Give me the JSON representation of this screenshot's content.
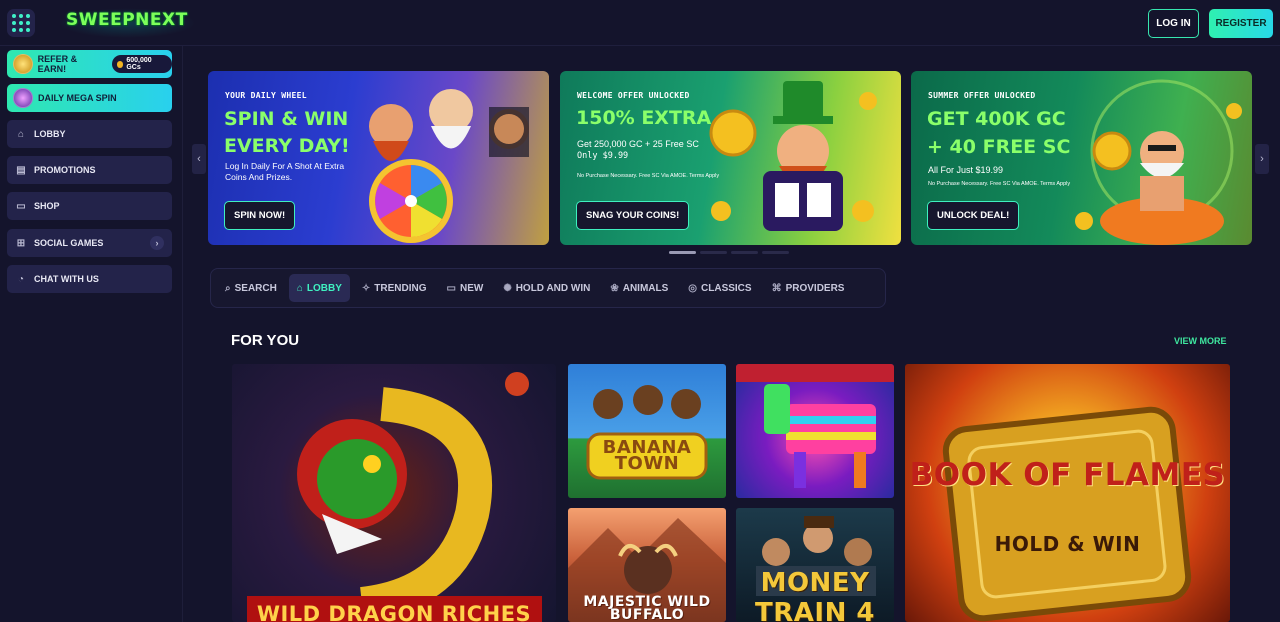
{
  "header": {
    "logo_text": "SWEEPNEXT",
    "login_label": "LOG IN",
    "register_label": "REGISTER"
  },
  "sidebar": {
    "refer": {
      "label": "REFER & EARN!",
      "badge": "600,000 GCs"
    },
    "mega_spin": {
      "label": "DAILY MEGA SPIN"
    },
    "items": [
      {
        "label": "LOBBY",
        "icon": "home-icon"
      },
      {
        "label": "PROMOTIONS",
        "icon": "gift-icon"
      },
      {
        "label": "SHOP",
        "icon": "shop-icon"
      },
      {
        "label": "SOCIAL GAMES",
        "icon": "games-icon"
      },
      {
        "label": "CHAT WITH US",
        "icon": "chat-icon"
      }
    ]
  },
  "banners": [
    {
      "kicker": "YOUR DAILY WHEEL",
      "title": "SPIN & WIN EVERY DAY!",
      "desc": "Log In Daily For A Shot At Extra Coins And Prizes.",
      "button": "SPIN NOW!"
    },
    {
      "kicker": "WELCOME OFFER UNLOCKED",
      "title": "150% EXTRA",
      "desc_line1": "Get 250,000 GC + 25 Free SC",
      "desc_line2": "Only $9.99",
      "fine": "No Purchase Necessary. Free SC Via AMOE. Terms Apply",
      "button": "SNAG YOUR COINS!"
    },
    {
      "kicker": "SUMMER OFFER UNLOCKED",
      "title": "GET 400K GC + 40 FREE SC",
      "desc_line1": "All For Just $19.99",
      "fine": "No Purchase Necessary. Free SC Via AMOE. Terms Apply",
      "button": "UNLOCK DEAL!"
    }
  ],
  "filters": [
    {
      "label": "SEARCH",
      "icon": "search-icon",
      "active": false
    },
    {
      "label": "LOBBY",
      "icon": "home-icon",
      "active": true
    },
    {
      "label": "TRENDING",
      "icon": "trending-icon",
      "active": false
    },
    {
      "label": "NEW",
      "icon": "new-icon",
      "active": false
    },
    {
      "label": "HOLD AND WIN",
      "icon": "hold-icon",
      "active": false
    },
    {
      "label": "ANIMALS",
      "icon": "paw-icon",
      "active": false
    },
    {
      "label": "CLASSICS",
      "icon": "classic-icon",
      "active": false
    },
    {
      "label": "PROVIDERS",
      "icon": "providers-icon",
      "active": false
    }
  ],
  "section": {
    "title": "FOR YOU",
    "view_more": "VIEW MORE"
  },
  "games": [
    {
      "name": "WILD DRAGON RICHES"
    },
    {
      "name": "BANANA TOWN"
    },
    {
      "name": ""
    },
    {
      "name": "BOOK OF FLAMES",
      "subtitle": "HOLD & WIN"
    },
    {
      "name": "MAJESTIC WILD BUFFALO"
    },
    {
      "name": "MONEY TRAIN 4"
    }
  ],
  "colors": {
    "accent": "#3ff0c0",
    "background": "#14142c",
    "panel": "#23234a"
  }
}
